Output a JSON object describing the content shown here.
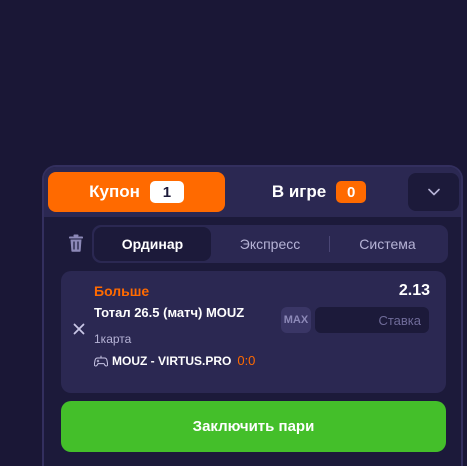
{
  "tabs": {
    "coupon": {
      "label": "Купон",
      "count": "1"
    },
    "in_game": {
      "label": "В игре",
      "count": "0"
    }
  },
  "icons": {
    "collapse": "chevron-down-icon",
    "trash": "trash-icon",
    "close": "close-icon",
    "controller": "gamepad-icon"
  },
  "modes": [
    "Ординар",
    "Экспресс",
    "Система"
  ],
  "active_mode": "Ординар",
  "bet": {
    "type": "Больше",
    "odds": "2.13",
    "market": "Тотал 26.5 (матч) MOUZ",
    "map": "1карта",
    "event": "MOUZ - VIRTUS.PRO",
    "score": "0:0",
    "max_label": "MAX",
    "stake_placeholder": "Ставка",
    "stake_value": ""
  },
  "submit_label": "Заключить пари",
  "colors": {
    "accent": "#ff6a00",
    "submit": "#44bf2a",
    "background": "#1a1736",
    "card": "#2b2852"
  }
}
